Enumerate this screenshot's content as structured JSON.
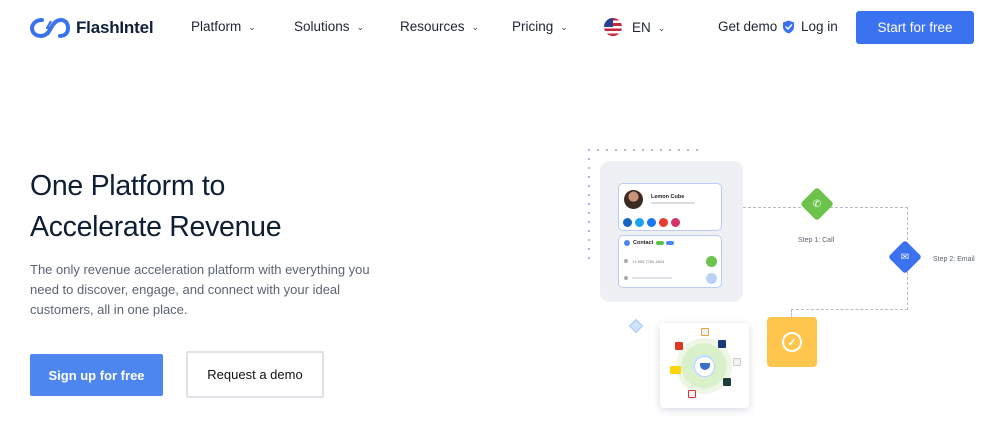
{
  "brand": {
    "name": "FlashIntel",
    "color": "#3b72ef"
  },
  "nav": {
    "items": [
      {
        "label": "Platform"
      },
      {
        "label": "Solutions"
      },
      {
        "label": "Resources"
      },
      {
        "label": "Pricing"
      }
    ],
    "language": "EN",
    "get_demo": "Get demo",
    "login": "Log in",
    "start_button": "Start for free"
  },
  "hero": {
    "title_line1": "One Platform to",
    "title_line2": "Accelerate Revenue",
    "subtitle": "The only revenue acceleration platform with everything you need to discover, engage, and connect with your ideal customers, all in one place.",
    "signup_button": "Sign up for free",
    "demo_button": "Request a demo"
  },
  "illustration": {
    "profile_name": "Lemon Cube",
    "contact_label": "Contact",
    "phone": "+1 555 7760 4624",
    "step1_label": "Step 1: Call",
    "step2_label": "Step 2: Email",
    "colors": {
      "call": "#6cc24a",
      "email": "#3b72ef",
      "done": "#ffc54d"
    }
  }
}
